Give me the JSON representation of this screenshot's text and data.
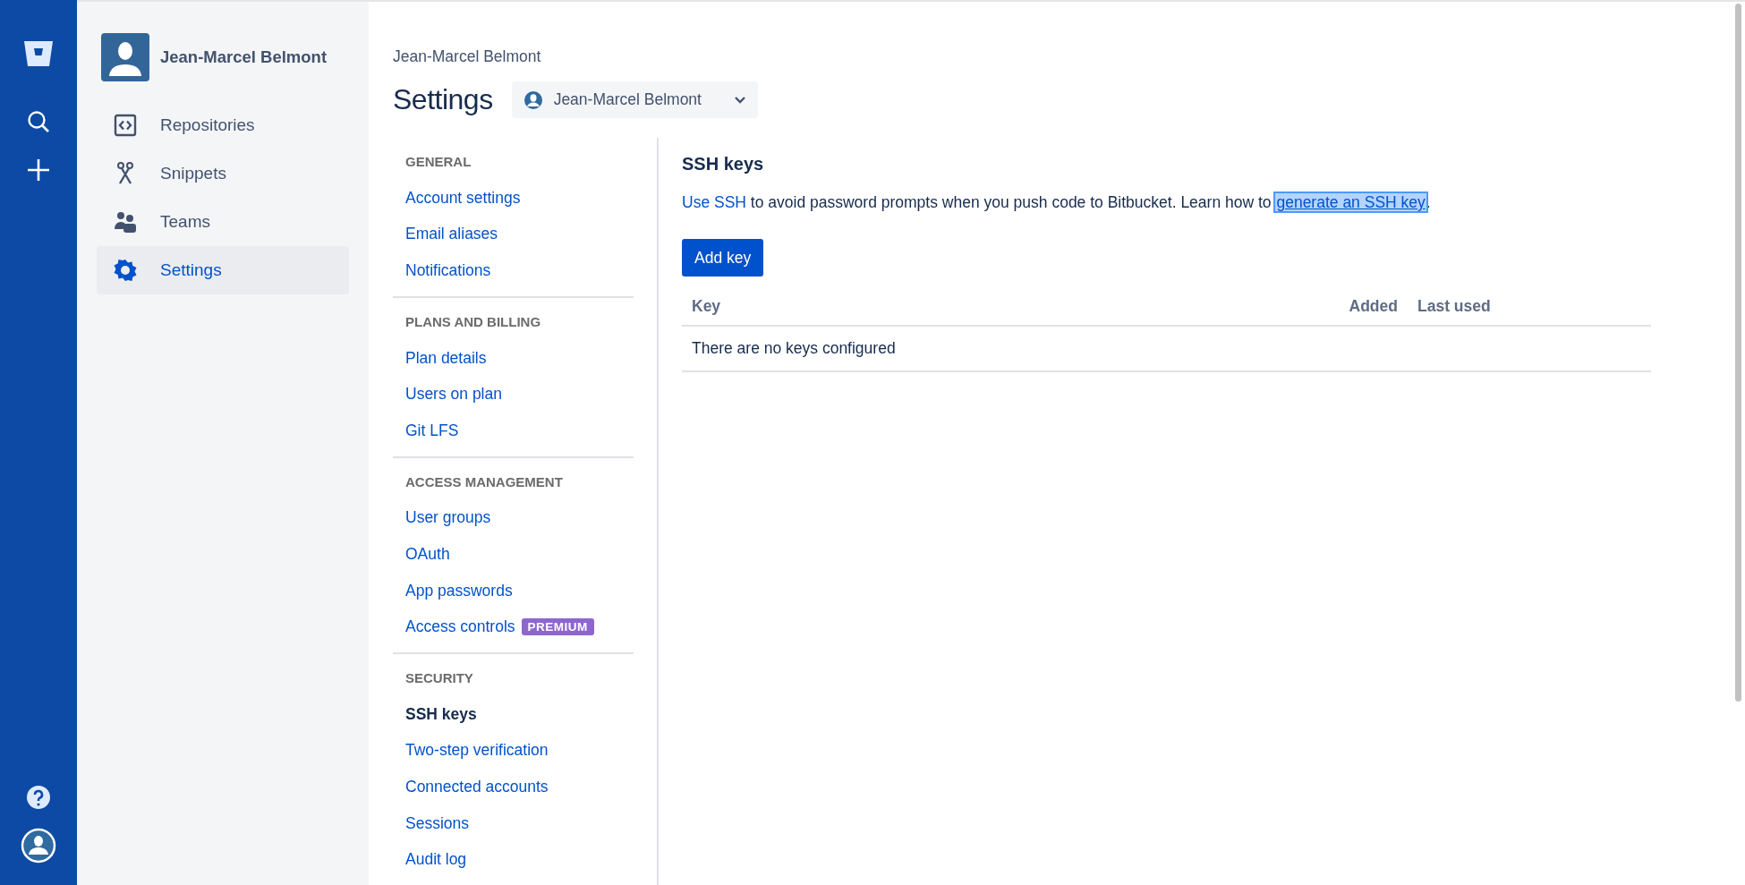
{
  "sidebar": {
    "user_name": "Jean-Marcel Belmont",
    "items": [
      {
        "label": "Repositories",
        "kind": "repositories",
        "selected": false
      },
      {
        "label": "Snippets",
        "kind": "snippets",
        "selected": false
      },
      {
        "label": "Teams",
        "kind": "teams",
        "selected": false
      },
      {
        "label": "Settings",
        "kind": "settings",
        "selected": true
      }
    ]
  },
  "header": {
    "breadcrumb": "Jean-Marcel Belmont",
    "title": "Settings",
    "account_switcher": "Jean-Marcel Belmont"
  },
  "settings_nav": {
    "sections": [
      {
        "heading": "GENERAL",
        "items": [
          {
            "label": "Account settings",
            "selected": false
          },
          {
            "label": "Email aliases",
            "selected": false
          },
          {
            "label": "Notifications",
            "selected": false
          }
        ]
      },
      {
        "heading": "PLANS AND BILLING",
        "items": [
          {
            "label": "Plan details",
            "selected": false
          },
          {
            "label": "Users on plan",
            "selected": false
          },
          {
            "label": "Git LFS",
            "selected": false
          }
        ]
      },
      {
        "heading": "ACCESS MANAGEMENT",
        "items": [
          {
            "label": "User groups",
            "selected": false
          },
          {
            "label": "OAuth",
            "selected": false
          },
          {
            "label": "App passwords",
            "selected": false
          },
          {
            "label": "Access controls",
            "selected": false,
            "badge": "PREMIUM"
          }
        ]
      },
      {
        "heading": "SECURITY",
        "items": [
          {
            "label": "SSH keys",
            "selected": true
          },
          {
            "label": "Two-step verification",
            "selected": false
          },
          {
            "label": "Connected accounts",
            "selected": false
          },
          {
            "label": "Sessions",
            "selected": false
          },
          {
            "label": "Audit log",
            "selected": false
          }
        ]
      }
    ]
  },
  "content": {
    "title": "SSH keys",
    "intro": [
      {
        "kind": "link",
        "text": "Use SSH",
        "focused": false
      },
      {
        "kind": "text",
        "text": " to avoid password prompts when you push code to Bitbucket. Learn how to "
      },
      {
        "kind": "link",
        "text": "generate an SSH key",
        "focused": true
      },
      {
        "kind": "text",
        "text": "."
      }
    ],
    "add_button": "Add key",
    "table": {
      "columns": [
        "Key",
        "Added",
        "Last used"
      ],
      "empty_message": "There are no keys configured"
    }
  }
}
